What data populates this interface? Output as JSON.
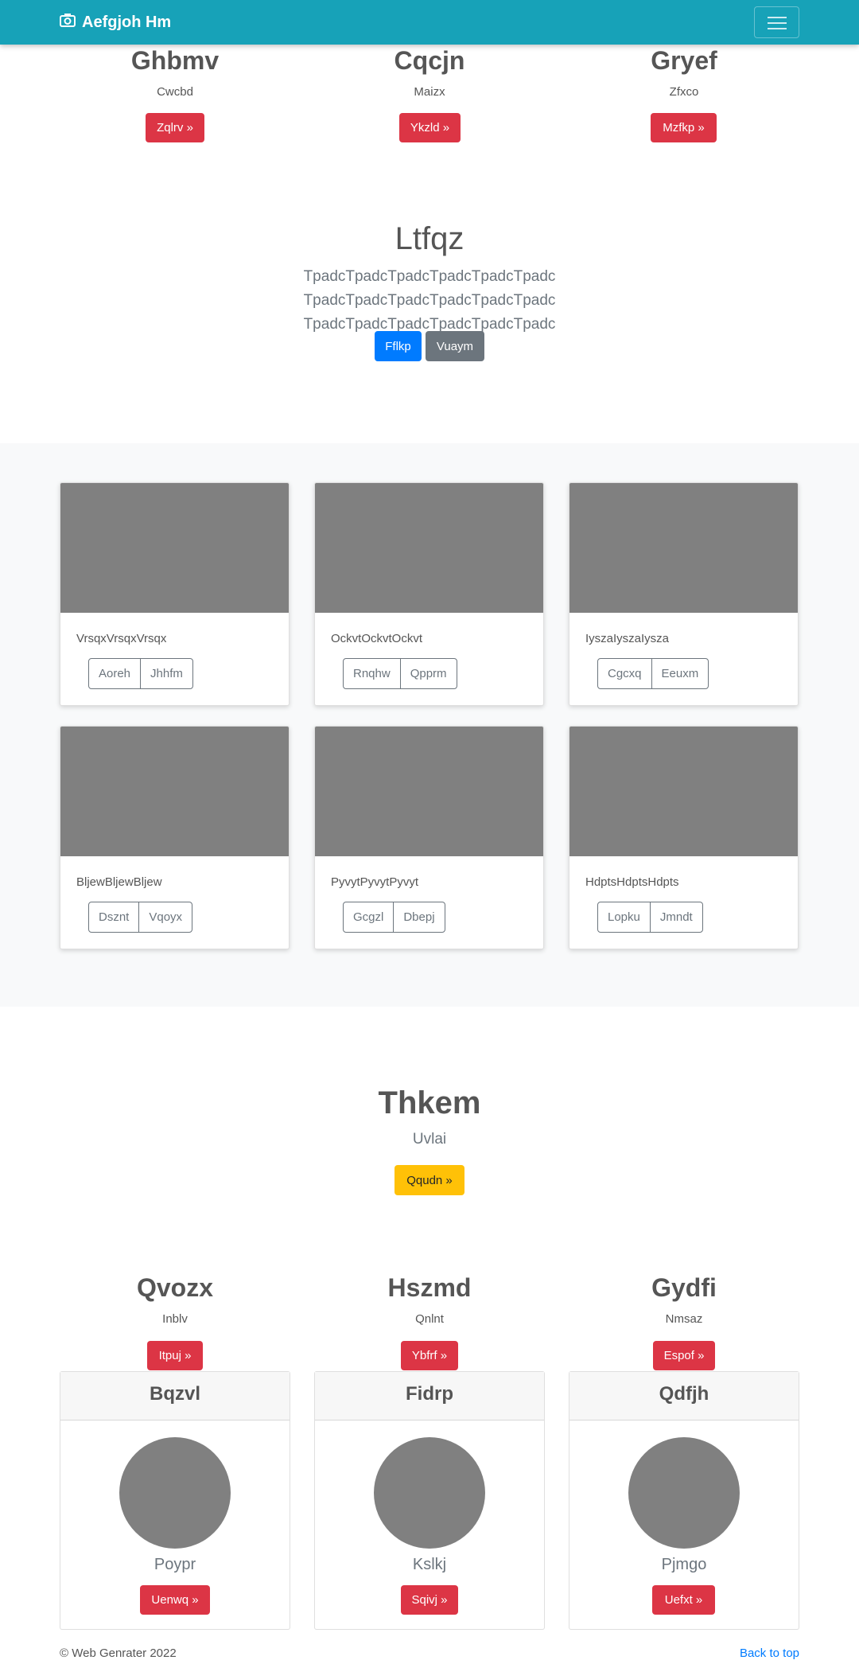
{
  "navbar": {
    "brand": "Aefgjoh Hm"
  },
  "headings_top": [
    {
      "title": "Ghbmv",
      "sub": "Cwcbd",
      "button": "Zqlrv »"
    },
    {
      "title": "Cqcjn",
      "sub": "Maizx",
      "button": "Ykzld »"
    },
    {
      "title": "Gryef",
      "sub": "Zfxco",
      "button": "Mzfkp »"
    }
  ],
  "hero": {
    "title": "Ltfqz",
    "lead": "TpadcTpadcTpadcTpadcTpadcTpadc TpadcTpadcTpadcTpadcTpadcTpadc TpadcTpadcTpadcTpadcTpadcTpadc",
    "primary": "Fflkp",
    "secondary": "Vuaym"
  },
  "album": [
    {
      "text": "VrsqxVrsqxVrsqx",
      "b1": "Aoreh",
      "b2": "Jhhfm"
    },
    {
      "text": "OckvtOckvtOckvt",
      "b1": "Rnqhw",
      "b2": "Qpprm"
    },
    {
      "text": "IyszaIyszaIysza",
      "b1": "Cgcxq",
      "b2": "Eeuxm"
    },
    {
      "text": "BljewBljewBljew",
      "b1": "Dsznt",
      "b2": "Vqoyx"
    },
    {
      "text": "PyvytPyvytPyvyt",
      "b1": "Gcgzl",
      "b2": "Dbepj"
    },
    {
      "text": "HdptsHdptsHdpts",
      "b1": "Lopku",
      "b2": "Jmndt"
    }
  ],
  "jumbo": {
    "title": "Thkem",
    "sub": "Uvlai",
    "button": "Qqudn »"
  },
  "headings_bottom": [
    {
      "title": "Qvozx",
      "sub": "Inblv",
      "button": "Itpuj »"
    },
    {
      "title": "Hszmd",
      "sub": "Qnlnt",
      "button": "Ybfrf »"
    },
    {
      "title": "Gydfi",
      "sub": "Nmsaz",
      "button": "Espof »"
    }
  ],
  "profiles": [
    {
      "header": "Bqzvl",
      "name": "Poypr",
      "button": "Uenwq »"
    },
    {
      "header": "Fidrp",
      "name": "Kslkj",
      "button": "Sqivj »"
    },
    {
      "header": "Qdfjh",
      "name": "Pjmgo",
      "button": "Uefxt »"
    }
  ],
  "footer": {
    "copyright": "© Web Genrater 2022",
    "back_to_top": "Back to top"
  },
  "colors": {
    "navbar": "#17a2b8",
    "danger": "#dc3545",
    "primary": "#007bff",
    "secondary": "#6c757d",
    "warning": "#ffc107"
  }
}
